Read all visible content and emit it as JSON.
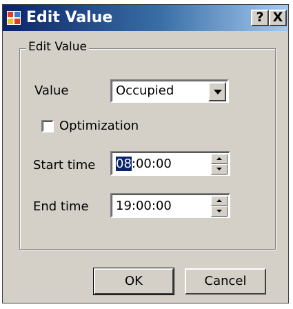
{
  "window": {
    "title": "Edit Value",
    "help_label": "?",
    "close_label": "X"
  },
  "group": {
    "legend": "Edit Value"
  },
  "value_field": {
    "label": "Value",
    "selected": "Occupied"
  },
  "optimization": {
    "label": "Optimization",
    "checked": false
  },
  "start_time": {
    "label": "Start time",
    "selected_part": "08",
    "rest": ":00:00"
  },
  "end_time": {
    "label": "End time",
    "value": "19:00:00"
  },
  "buttons": {
    "ok": "OK",
    "cancel": "Cancel"
  },
  "colors": {
    "titlebar_start": "#0a246a",
    "titlebar_end": "#a6caf0",
    "face": "#d4d0c8",
    "selection": "#0a246a"
  },
  "icons": {
    "app": "dialog-app-icon",
    "dropdown": "chevron-down-icon",
    "spin_up": "arrow-up-icon",
    "spin_down": "arrow-down-icon"
  }
}
